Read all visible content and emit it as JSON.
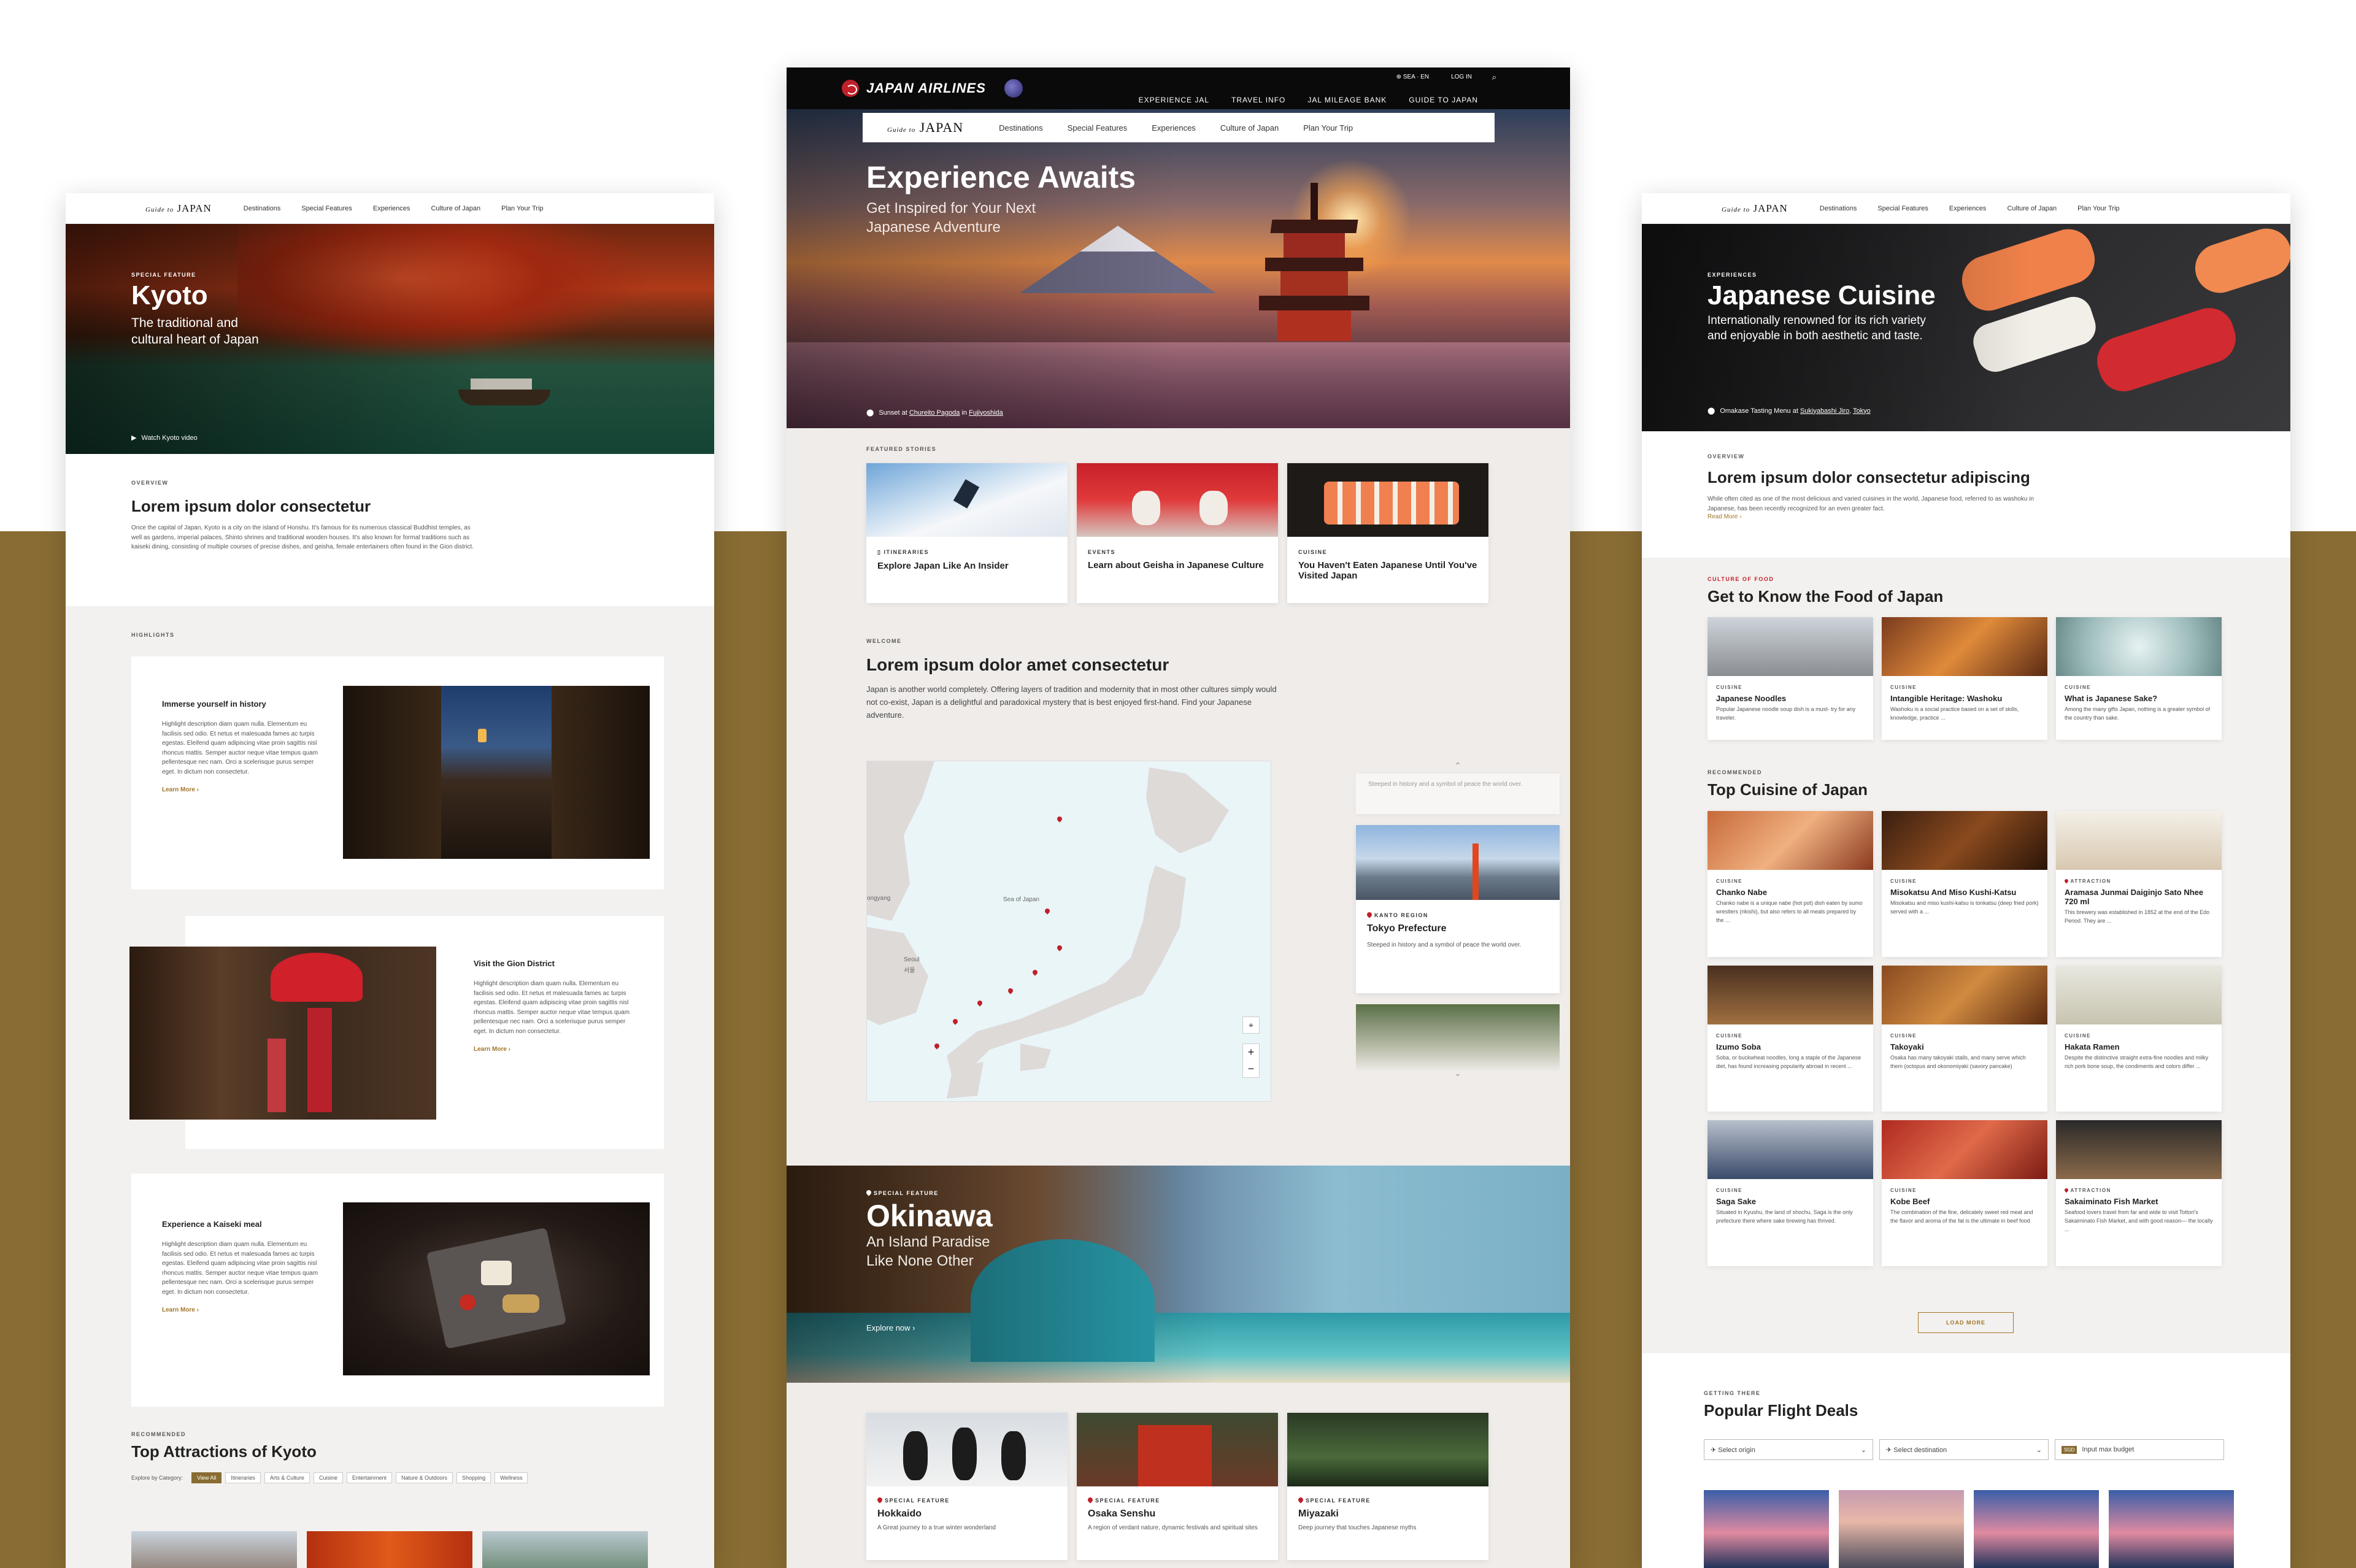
{
  "colors": {
    "bg": "#ffffff",
    "band": "#886c33",
    "accent": "#a0762a",
    "red": "#c0202a",
    "nav_dark": "#0a0a0a",
    "center_bg": "#efecea"
  },
  "subnav": {
    "brand_script": "Guide to",
    "brand_main": "JAPAN",
    "items": [
      "Destinations",
      "Special Features",
      "Experiences",
      "Culture of Japan",
      "Plan Your Trip"
    ]
  },
  "left": {
    "hero": {
      "kicker": "Special Feature",
      "title": "Kyoto",
      "subtitle_1": "The traditional and",
      "subtitle_2": "cultural heart of Japan",
      "video": "Watch Kyoto video"
    },
    "overview": {
      "kicker": "Overview",
      "title": "Lorem ipsum dolor consectetur",
      "body": "Once the capital of Japan, Kyoto is a city on the island of Honshu. It's famous for its numerous classical Buddhist temples, as well as gardens, imperial palaces, Shinto shrines and traditional wooden houses. It's also known for formal traditions such as kaiseki dining, consisting of multiple courses of precise dishes, and geisha, female entertainers often found in the Gion district."
    },
    "highlights_kicker": "Highlights",
    "highlights": [
      {
        "title": "Immerse yourself in history",
        "body": "Highlight description diam quam nulla. Elementum eu facilisis sed odio. Et netus et malesuada fames ac turpis egestas. Eleifend quam adipiscing vitae proin sagittis nisl rhoncus mattis. Semper auctor neque vitae tempus quam pellentesque nec nam. Orci a scelerisque purus semper eget. In dictum non consectetur.",
        "link": "Learn More"
      },
      {
        "title": "Visit the Gion District",
        "body": "Highlight description diam quam nulla. Elementum eu facilisis sed odio. Et netus et malesuada fames ac turpis egestas. Eleifend quam adipiscing vitae proin sagittis nisl rhoncus mattis. Semper auctor neque vitae tempus quam pellentesque nec nam. Orci a scelerisque purus semper eget. In dictum non consectetur.",
        "link": "Learn More"
      },
      {
        "title": "Experience a Kaiseki meal",
        "body": "Highlight description diam quam nulla. Elementum eu facilisis sed odio. Et netus et malesuada fames ac turpis egestas. Eleifend quam adipiscing vitae proin sagittis nisl rhoncus mattis. Semper auctor neque vitae tempus quam pellentesque nec nam. Orci a scelerisque purus semper eget. In dictum non consectetur.",
        "link": "Learn More"
      }
    ],
    "attractions": {
      "kicker": "Recommended",
      "title": "Top Attractions of Kyoto",
      "filter_label": "Explore by Category:",
      "tags": [
        "View All",
        "Itineraries",
        "Arts & Culture",
        "Cuisine",
        "Entertainment",
        "Nature & Outdoors",
        "Shopping",
        "Wellness"
      ]
    }
  },
  "center": {
    "jal": {
      "logo": "JAPAN AIRLINES",
      "lang": "SEA · EN",
      "login": "LOG IN",
      "menu": [
        "EXPERIENCE JAL",
        "TRAVEL INFO",
        "JAL MILEAGE BANK",
        "GUIDE TO JAPAN"
      ]
    },
    "nav": {
      "brand_script": "Guide to",
      "brand_main": "JAPAN",
      "items": [
        "Destinations",
        "Special Features",
        "Experiences",
        "Culture of Japan",
        "Plan Your Trip"
      ]
    },
    "hero": {
      "title": "Experience Awaits",
      "subtitle_1": "Get Inspired for Your Next",
      "subtitle_2": "Japanese Adventure",
      "caption_pre": "Sunset at",
      "caption_link1": "Chureito Pagoda",
      "caption_mid": "in",
      "caption_link2": "Fujiyoshida"
    },
    "featured_kicker": "Featured Stories",
    "featured": [
      {
        "cat": "Itineraries",
        "title": "Explore Japan Like An Insider"
      },
      {
        "cat": "Events",
        "title": "Learn about Geisha in Japanese Culture"
      },
      {
        "cat": "Cuisine",
        "title": "You Haven't Eaten Japanese Until You've Visited Japan"
      }
    ],
    "welcome": {
      "kicker": "Welcome",
      "title": "Lorem ipsum dolor amet consectetur",
      "body": "Japan is another world completely. Offering layers of tradition and modernity that in most other cultures simply would not co-exist, Japan is a delightful and paradoxical mystery that is best enjoyed first-hand. Find your Japanese adventure."
    },
    "map": {
      "sea_label": "Sea of Japan",
      "city1": "Seoul",
      "city1_local": "서울",
      "region": "ongyang"
    },
    "region_cards": [
      {
        "faded": "Steeped in history and a symbol of peace the world over."
      },
      {
        "cat": "Kanto Region",
        "title": "Tokyo Prefecture",
        "body": "Steeped in history and a symbol of peace the world over."
      }
    ],
    "okinawa": {
      "kicker": "Special Feature",
      "title": "Okinawa",
      "subtitle_1": "An Island Paradise",
      "subtitle_2": "Like None Other",
      "cta": "Explore now"
    },
    "specials": [
      {
        "cat": "Special Feature",
        "title": "Hokkaido",
        "body": "A Great journey to a true winter wonderland"
      },
      {
        "cat": "Special Feature",
        "title": "Osaka Senshu",
        "body": "A region of verdant nature, dynamic festivals and spiritual sites"
      },
      {
        "cat": "Special Feature",
        "title": "Miyazaki",
        "body": "Deep journey that touches Japanese myths"
      }
    ]
  },
  "right": {
    "hero": {
      "kicker": "Experiences",
      "title": "Japanese Cuisine",
      "subtitle_1": "Internationally renowned for its rich variety",
      "subtitle_2": "and enjoyable in both aesthetic and taste.",
      "caption_pre": "Omakase Tasting Menu at",
      "caption_link1": "Sukiyabashi Jiro",
      "caption_link2": "Tokyo"
    },
    "overview": {
      "kicker": "Overview",
      "title": "Lorem ipsum dolor consectetur adipiscing",
      "body": "While often cited as one of the most delicious and varied cuisines in the world, Japanese food, referred to as washoku in Japanese, has been recently recognized for an even greater fact.",
      "link": "Read More"
    },
    "food": {
      "kicker": "Culture of Food",
      "title": "Get to Know the Food of Japan",
      "items": [
        {
          "cat": "Cuisine",
          "title": "Japanese Noodles",
          "body": "Popular Japanese noodle soup dish is a must- try for any traveler."
        },
        {
          "cat": "Cuisine",
          "title": "Intangible Heritage: Washoku",
          "body": "Washoku is a social practice based on a set of skills, knowledge, practice ..."
        },
        {
          "cat": "Cuisine",
          "title": "What is Japanese Sake?",
          "body": "Among the many gifts Japan, nothing is a greater symbol of the country than sake."
        }
      ]
    },
    "top": {
      "kicker": "Recommended",
      "title": "Top Cuisine of Japan",
      "items": [
        {
          "cat": "Cuisine",
          "title": "Chanko Nabe",
          "body": "Chanko nabe is a unique nabe (hot pot) dish eaten by sumo wrestlers (rikishi), but also refers to all meals prepared by the ..."
        },
        {
          "cat": "Cuisine",
          "title": "Misokatsu And Miso Kushi-Katsu",
          "body": "Misokatsu and miso kushi-katsu is tonkatsu (deep fried pork) served with a ..."
        },
        {
          "cat": "Attraction",
          "title": "Aramasa Junmai Daiginjo Sato Nhee 720 ml",
          "body": "This brewery was established in 1852 at the end of the Edo Period. They are ..."
        },
        {
          "cat": "Cuisine",
          "title": "Izumo Soba",
          "body": "Soba, or buckwheat noodles, long a staple of the Japanese diet, has found increasing popularity abroad in recent ..."
        },
        {
          "cat": "Cuisine",
          "title": "Takoyaki",
          "body": "Osaka has many takoyaki stalls, and many serve which them (octopus and okonomiyaki (savory pancake)"
        },
        {
          "cat": "Cuisine",
          "title": "Hakata Ramen",
          "body": "Despite the distinctive straight extra-fine noodles and milky rich pork bone soup, the condiments and colors differ ..."
        },
        {
          "cat": "Cuisine",
          "title": "Saga Sake",
          "body": "Situated in Kyushu, the land of shochu, Saga is the only prefecture there where sake brewing has thrived."
        },
        {
          "cat": "Cuisine",
          "title": "Kobe Beef",
          "body": "The combination of the fine, delicately sweet red meat and the flavor and aroma of the fat is the ultimate in beef food"
        },
        {
          "cat": "Attraction",
          "title": "Sakaiminato Fish Market",
          "body": "Seafood lovers travel from far and wide to visit Tottori's Sakaiminato Fish Market, and with good reason— the locally ..."
        }
      ],
      "load_more": "Load More"
    },
    "flights": {
      "kicker": "Getting There",
      "title": "Popular Flight Deals",
      "origin": "Select origin",
      "destination": "Select destination",
      "budget_cur": "SGD",
      "budget": "Input max budget"
    }
  }
}
